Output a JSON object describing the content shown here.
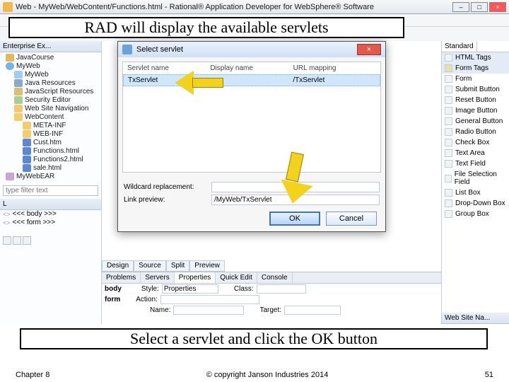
{
  "window": {
    "title": "Web - MyWeb/WebContent/Functions.html - Rational® Application Developer for WebSphere® Software"
  },
  "banner_top": "RAD will display the available servlets",
  "banner_bottom": "Select a servlet and click the OK button",
  "footer": {
    "left": "Chapter 8",
    "center": "© copyright Janson Industries 2014",
    "right": "51"
  },
  "sidebar": {
    "panel_title": "Enterprise Ex...",
    "items": [
      {
        "label": "JavaCourse",
        "cls": "proj",
        "ind": 0
      },
      {
        "label": "MyWeb",
        "cls": "web",
        "ind": 0
      },
      {
        "label": "MyWeb",
        "cls": "pkg",
        "ind": 1
      },
      {
        "label": "Java Resources",
        "cls": "lib",
        "ind": 1
      },
      {
        "label": "JavaScript Resources",
        "cls": "js",
        "ind": 1
      },
      {
        "label": "Security Editor",
        "cls": "edit",
        "ind": 1
      },
      {
        "label": "Web Site Navigation",
        "cls": "nav",
        "ind": 1
      },
      {
        "label": "WebContent",
        "cls": "folder",
        "ind": 1
      },
      {
        "label": "META-INF",
        "cls": "folder",
        "ind": 2
      },
      {
        "label": "WEB-INF",
        "cls": "folder",
        "ind": 2
      },
      {
        "label": "Cust.htm",
        "cls": "html",
        "ind": 2
      },
      {
        "label": "Functions.html",
        "cls": "html",
        "ind": 2
      },
      {
        "label": "Functions2.html",
        "cls": "html",
        "ind": 2
      },
      {
        "label": "sale.html",
        "cls": "html",
        "ind": 2
      },
      {
        "label": "MyWebEAR",
        "cls": "ear",
        "ind": 0
      }
    ],
    "filter_placeholder": "type filter text"
  },
  "outline": {
    "header": "L",
    "items": [
      "<<< body >>>",
      "<<< form >>>"
    ]
  },
  "editor_tabs": [
    "Design",
    "Source",
    "Split",
    "Preview"
  ],
  "bottom_tabs": [
    "Problems",
    "Servers",
    "Properties",
    "Quick Edit",
    "Console"
  ],
  "properties": {
    "element": "body",
    "sub": "form",
    "style_label": "Style:",
    "style_value": "Properties",
    "class_label": "Class:",
    "action_label": "Action:",
    "name_label": "Name:",
    "target_label": "Target:"
  },
  "palette": {
    "tabs": [
      "HTML Tags",
      "Form Tags"
    ],
    "standard": "Standard",
    "items": [
      "Form",
      "Submit Button",
      "Reset Button",
      "Image Button",
      "General Button",
      "Radio Button",
      "Check Box",
      "Text Area",
      "Text Field",
      "File Selection Field",
      "List Box",
      "Drop-Down Box",
      "Group Box"
    ]
  },
  "right_title": "Web Site Na...",
  "dialog": {
    "title": "Select servlet",
    "close_x": "×",
    "cols": [
      "Servlet name",
      "Display name",
      "URL mapping"
    ],
    "rows": [
      {
        "servlet": "TxServlet",
        "display": "",
        "url": "/TxServlet"
      }
    ],
    "wildcard_label": "Wildcard replacement:",
    "wildcard_value": "",
    "preview_label": "Link preview:",
    "preview_value": "/MyWeb/TxServlet",
    "ok": "OK",
    "cancel": "Cancel"
  }
}
